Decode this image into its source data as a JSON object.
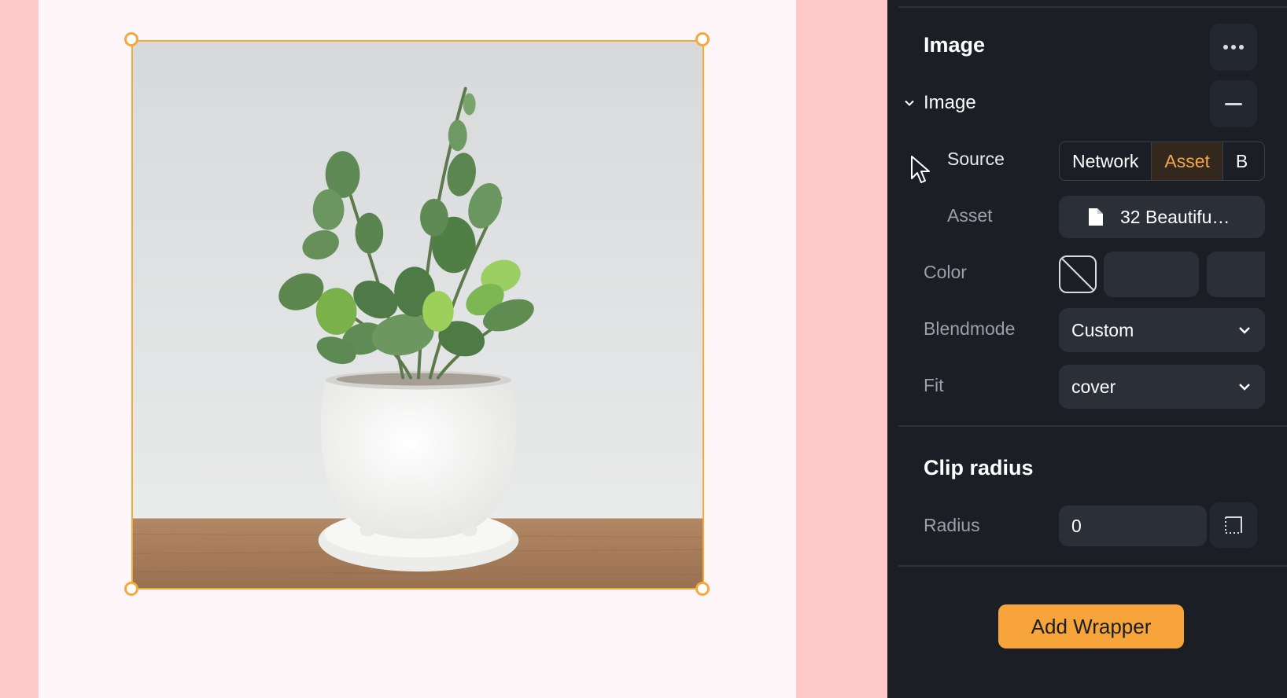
{
  "canvas": {
    "image_name": "potted plant image",
    "selection_color": "#f5a93c"
  },
  "panel": {
    "section_title": "Image",
    "more_icon": "more-horizontal-icon",
    "image_group": {
      "label": "Image",
      "collapse_icon": "chevron-down-icon",
      "remove_icon": "minus-icon"
    },
    "source": {
      "label": "Source",
      "options": [
        "Network",
        "Asset",
        "B"
      ],
      "selected": "Asset"
    },
    "asset": {
      "label": "Asset",
      "file_icon": "file-icon",
      "value": "32 Beautifu…"
    },
    "color": {
      "label": "Color",
      "swatch_icon": "no-color-icon"
    },
    "blendmode": {
      "label": "Blendmode",
      "value": "Custom"
    },
    "fit": {
      "label": "Fit",
      "value": "cover"
    },
    "clip_radius": {
      "title": "Clip radius",
      "radius_label": "Radius",
      "radius_value": "0",
      "corner_icon": "corner-radius-icon"
    },
    "add_wrapper_label": "Add Wrapper"
  },
  "colors": {
    "panel_bg": "#1b1e24",
    "field_bg": "#2a2f38",
    "accent": "#f7a53a",
    "canvas_bg": "#ffc9c9"
  }
}
